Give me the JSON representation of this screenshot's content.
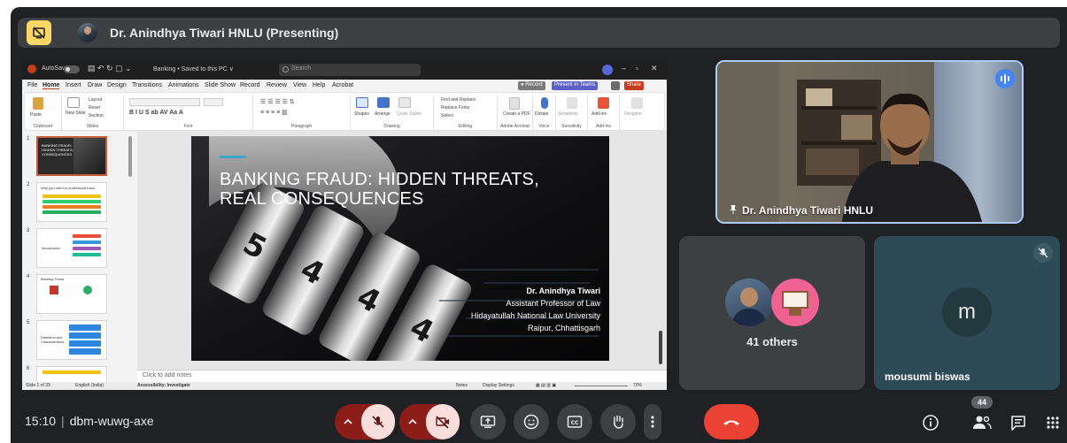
{
  "presenter_bar": {
    "title": "Dr. Anindhya Tiwari HNLU (Presenting)"
  },
  "shared_screen": {
    "app": {
      "autosave": "AutoSave",
      "doc_title": "Banking • Saved to this PC ∨",
      "search_placeholder": "Search",
      "menu": [
        "File",
        "Home",
        "Insert",
        "Draw",
        "Design",
        "Transitions",
        "Animations",
        "Slide Show",
        "Record",
        "Review",
        "View",
        "Help",
        "Acrobat"
      ],
      "record_label": "● Record",
      "teams_label": "Present in Teams",
      "share_label": "Share",
      "ribbon_groups": [
        "Clipboard",
        "Slides",
        "Font",
        "Paragraph",
        "Drawing",
        "Editing",
        "Adobe Acrobat",
        "Voice",
        "Sensitivity",
        "Add-ins",
        ""
      ],
      "ribbon_labels": {
        "paste": "Paste",
        "new_slide": "New Slide",
        "layout": "Layout",
        "reset": "Reset",
        "section": "Section",
        "shapes": "Shapes",
        "arrange": "Arrange",
        "quick_styles": "Quick Styles",
        "find_replace": "Find and Replace",
        "replace_fonts": "Replace Fonts",
        "select": "Select",
        "create_pdf": "Create a PDF",
        "dictate": "Dictate",
        "sensitivity": "Sensitivity",
        "add_ins": "Add-ins",
        "designer": "Designer"
      },
      "notes_placeholder": "Click to add notes",
      "status": {
        "slide": "Slide 1 of 33",
        "language": "English (India)",
        "accessibility": "Accessibility: Investigate",
        "notes": "Notes",
        "display": "Display Settings",
        "zoom": "70%"
      },
      "thumbnails": [
        {
          "num": "1",
          "title": "BANKING FRAUD: HIDDEN THREATS, REAL CONSEQUENCES"
        },
        {
          "num": "2",
          "title": "Why you need to understand fraud"
        },
        {
          "num": "3",
          "title": "Introduction"
        },
        {
          "num": "4",
          "title": "Banking Fraud"
        },
        {
          "num": "5",
          "title": "Definition and Characteristics"
        },
        {
          "num": "6",
          "title": ""
        }
      ]
    },
    "slide": {
      "title_line1": "BANKING FRAUD: HIDDEN THREATS,",
      "title_line2": "REAL CONSEQUENCES",
      "author_name": "Dr. Anindhya Tiwari",
      "author_role": "Assistant Professor of Law",
      "author_org": "Hidayatullah National Law University",
      "author_place": "Raipur, Chhattisgarh"
    }
  },
  "tiles": {
    "speaker_name": "Dr. Anindhya Tiwari HNLU",
    "others_label": "41 others",
    "mousumi_initial": "m",
    "mousumi_name": "mousumi biswas"
  },
  "bottom": {
    "time": "15:10",
    "meeting_code": "dbm-wuwg-axe",
    "participant_count": "44"
  },
  "colors": {
    "background": "#202124",
    "tile": "#3c4043",
    "muted_red": "#8c1d18",
    "hangup": "#ea4335",
    "speaking": "#4285f4",
    "accent_border": "#aecbfa"
  }
}
